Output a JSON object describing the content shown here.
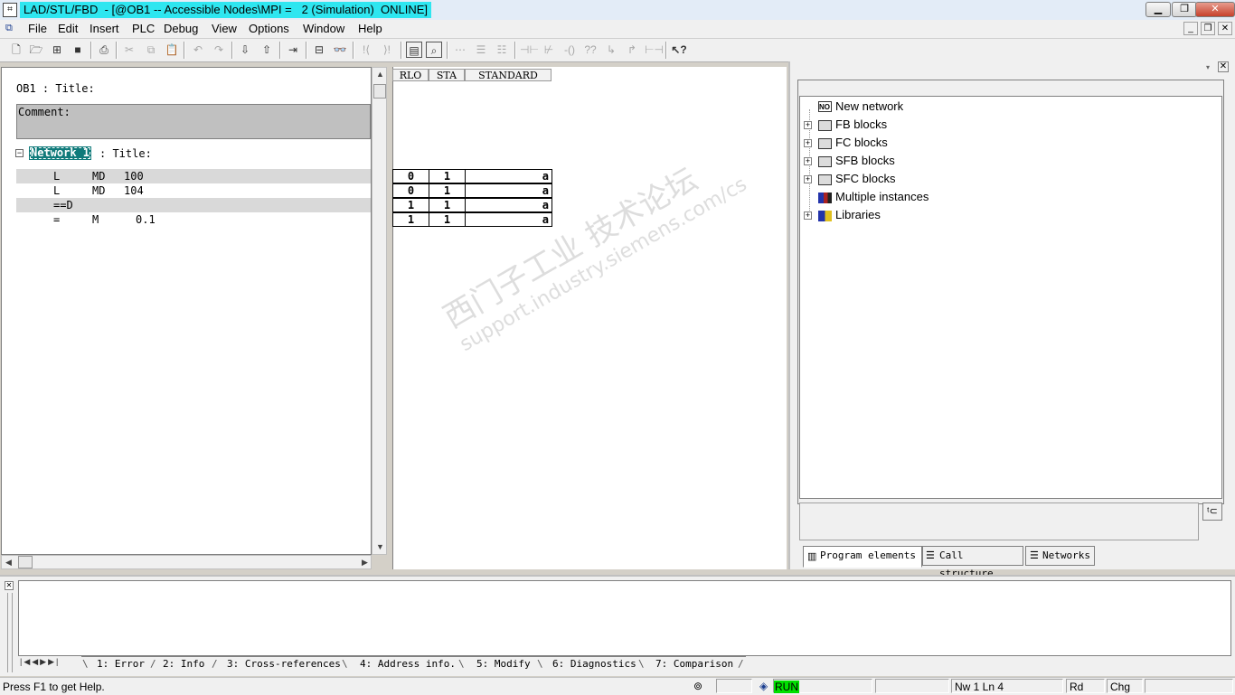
{
  "window": {
    "title": "LAD/STL/FBD  - [@OB1 -- Accessible Nodes\\MPI =   2 (Simulation)  ONLINE]",
    "controls": {
      "minimize": "▁",
      "maximize": "❐",
      "close": "✕"
    }
  },
  "menu": {
    "items": [
      "File",
      "Edit",
      "Insert",
      "PLC",
      "Debug",
      "View",
      "Options",
      "Window",
      "Help"
    ]
  },
  "toolbar": {
    "icons": [
      "new-icon",
      "open-icon",
      "accessible-nodes-icon",
      "save-icon",
      "print-icon",
      "cut-icon",
      "copy-icon",
      "paste-icon",
      "undo-icon",
      "redo-icon",
      "download-icon",
      "upload-icon",
      "go-to-icon",
      "overview-icon",
      "monitor-icon",
      "breakpoint-icon",
      "breakpoint-next-icon",
      "program-elements-icon",
      "zoom-icon",
      "network-icon",
      "ladder-icon",
      "branch-icon",
      "normally-open-icon",
      "normally-closed-icon",
      "coil-icon",
      "box-icon",
      "branch-open-icon",
      "branch-close-icon",
      "connection-icon",
      "help-icon"
    ]
  },
  "editor": {
    "block_title": "OB1 : Title:",
    "comment_label": "Comment:",
    "network_label": "Network 1",
    "network_title": ": Title:",
    "lines": [
      {
        "op": "L",
        "operand": "MD",
        "address": "100"
      },
      {
        "op": "L",
        "operand": "MD",
        "address": "104"
      },
      {
        "op": "==D",
        "operand": "",
        "address": ""
      },
      {
        "op": "=",
        "operand": "M",
        "address": "0.1"
      }
    ]
  },
  "status_table": {
    "headers": [
      "RLO",
      "STA",
      "STANDARD"
    ],
    "rows": [
      {
        "rlo": "0",
        "sta": "1",
        "standard": "a"
      },
      {
        "rlo": "0",
        "sta": "1",
        "standard": "a"
      },
      {
        "rlo": "1",
        "sta": "1",
        "standard": "a"
      },
      {
        "rlo": "1",
        "sta": "1",
        "standard": "a"
      }
    ]
  },
  "watermark": {
    "line1": "西门子工业  技术论坛",
    "line2": "support.industry.siemens.com/cs"
  },
  "program_elements": {
    "items": [
      {
        "label": "New network",
        "icon": "new-network-icon",
        "expandable": false
      },
      {
        "label": "FB blocks",
        "icon": "fb-blocks-icon",
        "expandable": true
      },
      {
        "label": "FC blocks",
        "icon": "fc-blocks-icon",
        "expandable": true
      },
      {
        "label": "SFB blocks",
        "icon": "sfb-blocks-icon",
        "expandable": true
      },
      {
        "label": "SFC blocks",
        "icon": "sfc-blocks-icon",
        "expandable": true
      },
      {
        "label": "Multiple instances",
        "icon": "multiple-instances-icon",
        "expandable": false
      },
      {
        "label": "Libraries",
        "icon": "libraries-icon",
        "expandable": true
      }
    ],
    "tabs": [
      "Program elements",
      "Call structure",
      "Networks"
    ]
  },
  "output": {
    "tabs": [
      "1: Error",
      "2: Info",
      "3: Cross-references",
      "4: Address info.",
      "5: Modify",
      "6: Diagnostics",
      "7: Comparison"
    ]
  },
  "statusbar": {
    "help": "Press F1 to get Help.",
    "mode": "RUN",
    "position": "Nw 1  Ln 4",
    "access": "Rd",
    "change": "Chg"
  },
  "colors": {
    "title_highlight": "#2ee6f0",
    "network_label_bg": "#0f7a7a",
    "run_indicator": "#00e000"
  }
}
